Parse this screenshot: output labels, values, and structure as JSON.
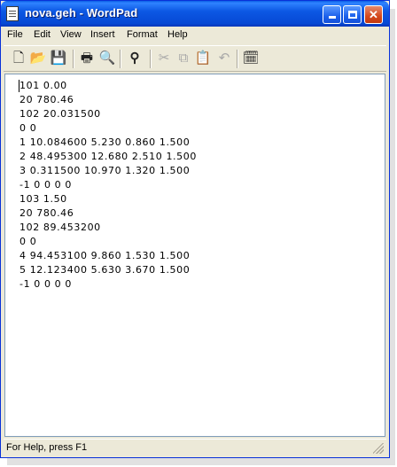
{
  "window": {
    "title": "nova.geh - WordPad"
  },
  "menu": {
    "items": [
      "File",
      "Edit",
      "View",
      "Insert",
      "Format",
      "Help"
    ]
  },
  "toolbar": {
    "buttons": [
      "new-icon",
      "open-icon",
      "save-icon",
      "print-icon",
      "print-preview-icon",
      "find-icon",
      "cut-icon",
      "copy-icon",
      "paste-icon",
      "undo-icon",
      "date-time-icon"
    ]
  },
  "document": {
    "lines": [
      "101 0.00",
      "20 780.46",
      "102 20.031500",
      "0 0",
      "1 10.084600 5.230 0.860 1.500",
      "2 48.495300 12.680 2.510 1.500",
      "3 0.311500 10.970 1.320 1.500",
      "-1 0 0 0 0",
      "103 1.50",
      "20 780.46",
      "102 89.453200",
      "0 0",
      "4 94.453100 9.860 1.530 1.500",
      "5 12.123400 5.630 3.670 1.500",
      "-1 0 0 0 0"
    ]
  },
  "status": {
    "text": "For Help, press F1"
  }
}
